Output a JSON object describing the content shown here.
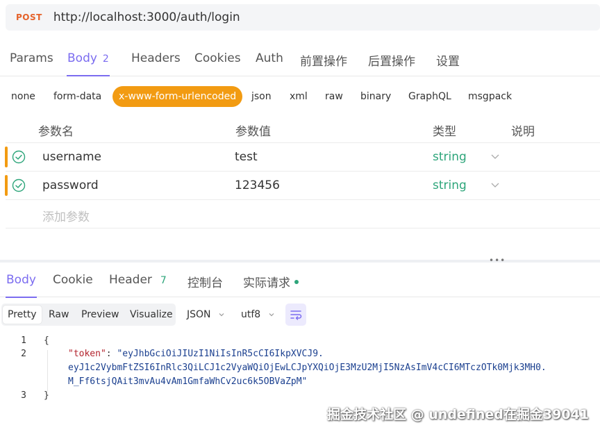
{
  "request": {
    "method": "POST",
    "url": "http://localhost:3000/auth/login"
  },
  "tabs": [
    {
      "label": "Params"
    },
    {
      "label": "Body",
      "badge": "2"
    },
    {
      "label": "Headers"
    },
    {
      "label": "Cookies"
    },
    {
      "label": "Auth"
    },
    {
      "label": "前置操作"
    },
    {
      "label": "后置操作"
    },
    {
      "label": "设置"
    }
  ],
  "body_types": [
    "none",
    "form-data",
    "x-www-form-urlencoded",
    "json",
    "xml",
    "raw",
    "binary",
    "GraphQL",
    "msgpack"
  ],
  "params_table": {
    "headers": {
      "name": "参数名",
      "value": "参数值",
      "type": "类型",
      "desc": "说明"
    },
    "rows": [
      {
        "name": "username",
        "value": "test",
        "type": "string"
      },
      {
        "name": "password",
        "value": "123456",
        "type": "string"
      }
    ],
    "add_placeholder": "添加参数"
  },
  "response_tabs": [
    {
      "label": "Body"
    },
    {
      "label": "Cookie"
    },
    {
      "label": "Header",
      "badge": "7"
    },
    {
      "label": "控制台"
    },
    {
      "label": "实际请求"
    }
  ],
  "viewer": {
    "modes": [
      "Pretty",
      "Raw",
      "Preview",
      "Visualize"
    ],
    "format": "JSON",
    "encoding": "utf8"
  },
  "code": {
    "line_numbers": [
      "1",
      "2",
      "3"
    ],
    "open": "{",
    "key": "\"token\"",
    "colon": ": ",
    "value_1": "\"eyJhbGciOiJIUzI1NiIsInR5cCI6IkpXVCJ9.",
    "value_2": "eyJ1c2VybmFtZSI6InRlc3QiLCJ1c2VyaWQiOjEwLCJpYXQiOjE3MzU2MjI5NzAsImV4cCI6MTczOTk0Mjk3MH0.",
    "value_3": "M_Ff6tsjQAit3mvAu4vAm1GmfaWhCv2uc6k5OBVaZpM\"",
    "close": "}"
  },
  "watermark": "掘金技术社区 @ undefined在掘金39041",
  "colors": {
    "accent": "#7b6cf0",
    "method": "#e5622a",
    "active_pill": "#f29b12",
    "type": "#2da57a"
  }
}
